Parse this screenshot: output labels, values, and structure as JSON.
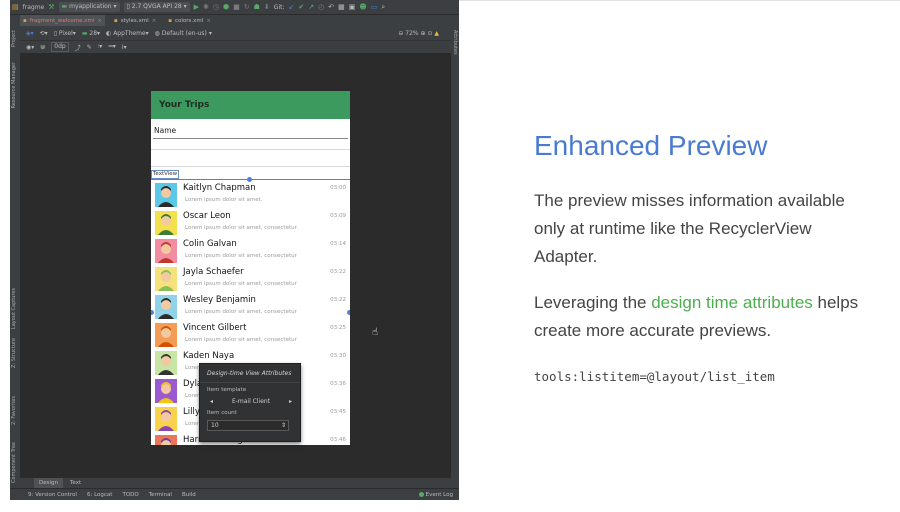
{
  "toolbar": {
    "module_icon_label": "fragme",
    "run_config": "myapplication",
    "device": "2.7 QVGA API 28",
    "git_label": "Git:"
  },
  "editor_tabs": [
    {
      "label": "fragment_welcome.xml",
      "active": true
    },
    {
      "label": "styles.xml",
      "active": false
    },
    {
      "label": "colors.xml",
      "active": false
    }
  ],
  "design_toolbar": {
    "device": "Pixel",
    "api": "28",
    "theme": "AppTheme",
    "locale": "Default (en-us)",
    "zoom": "72%"
  },
  "tools_toolbar": {
    "margin": "0dp"
  },
  "left_tool_windows": [
    "Project",
    "Resource Manager",
    "Layout Captures",
    "Z: Structure",
    "Favorites",
    "Build Variants"
  ],
  "right_tool_windows": [
    "Attributes"
  ],
  "left_tool_windows_bottom": [
    "2: Favorites",
    "Build Variants",
    "Component Tree"
  ],
  "phone": {
    "app_title": "Your Trips",
    "name_field": "Name",
    "textview_tag": "TextView",
    "rows": [
      {
        "name": "Kaitlyn Chapman",
        "sub": "Lorem ipsum dolor sit amet.",
        "time": "03:00",
        "avatar_bg": "#5cc8e8",
        "avatar_fg": "#2b2b2b"
      },
      {
        "name": "Oscar Leon",
        "sub": "Lorem ipsum dolor sit amet, consectetur.",
        "time": "03:09",
        "avatar_bg": "#f4e04d",
        "avatar_fg": "#3b7d3a"
      },
      {
        "name": "Colin Galvan",
        "sub": "Lorem ipsum dolor sit amet, consectetur",
        "time": "03:14",
        "avatar_bg": "#f28ca0",
        "avatar_fg": "#c0392b"
      },
      {
        "name": "Jayla Schaefer",
        "sub": "Lorem ipsum dolor sit amet, consectetur",
        "time": "03:22",
        "avatar_bg": "#f6e27a",
        "avatar_fg": "#88c057"
      },
      {
        "name": "Wesley Benjamin",
        "sub": "Lorem ipsum dolor sit amet, consectetur",
        "time": "03:22",
        "avatar_bg": "#8fd3e8",
        "avatar_fg": "#2b2b2b"
      },
      {
        "name": "Vincent Gilbert",
        "sub": "Lorem ipsum dolor sit amet, consectetur",
        "time": "03:25",
        "avatar_bg": "#f39c58",
        "avatar_fg": "#d35400"
      },
      {
        "name": "Kaden Naya",
        "sub": "Lorem ipsum dolor sit amet, consectetur.",
        "time": "03:30",
        "avatar_bg": "#c7e6a3",
        "avatar_fg": "#333333"
      },
      {
        "name": "Dyla",
        "sub": "Lorem",
        "time": "03:36",
        "avatar_bg": "#9b59d0",
        "avatar_fg": "#f1c40f"
      },
      {
        "name": "Lilly",
        "sub": "Lorem",
        "time": "03:45",
        "avatar_bg": "#f7d24a",
        "avatar_fg": "#8e44ad"
      },
      {
        "name": "Harrison Vaughn",
        "sub": "",
        "time": "03:46",
        "avatar_bg": "#e8765a",
        "avatar_fg": "#6b3fa0"
      }
    ]
  },
  "popup": {
    "title": "Design-time View Attributes",
    "template_label": "Item template",
    "template_value": "E-mail Client",
    "count_label": "Item count",
    "count_value": "10"
  },
  "bottom_tabs": [
    {
      "label": "Design",
      "active": true
    },
    {
      "label": "Text",
      "active": false
    }
  ],
  "status_bar": {
    "items": [
      "9: Version Control",
      "6: Logcat",
      "TODO",
      "Terminal",
      "Build"
    ],
    "event_log": "Event Log"
  },
  "slide": {
    "heading": "Enhanced Preview",
    "paragraph1": "The preview misses information available only at runtime like the RecyclerView Adapter.",
    "paragraph2_before": "Leveraging the ",
    "paragraph2_highlight": "design time attributes",
    "paragraph2_after": " helps create more accurate previews.",
    "code": "tools:listitem=@layout/list_item"
  },
  "colors": {
    "heading": "#4a7bd0",
    "highlight": "#4cae4f",
    "appbar": "#3c9a5f"
  }
}
